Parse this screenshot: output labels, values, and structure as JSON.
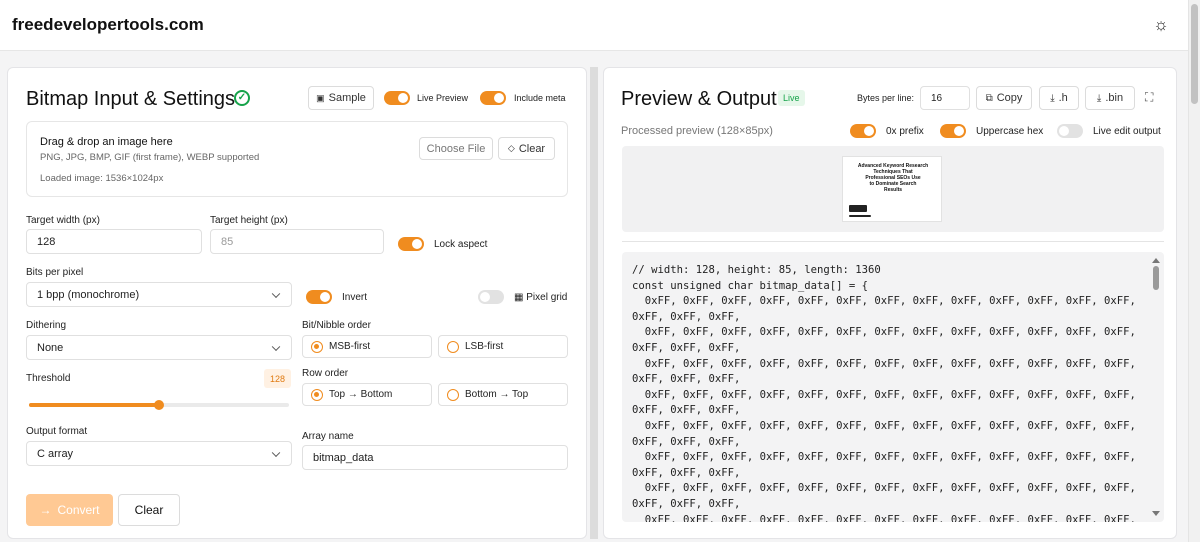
{
  "header": {
    "brand": "freedevelopertools.com",
    "theme_icon": "sun-icon"
  },
  "left": {
    "title": "Bitmap Input & Settings",
    "sample_label": "Sample",
    "live_preview_label": "Live Preview",
    "include_meta_label": "Include meta",
    "drop_title": "Drag & drop an image here",
    "drop_formats": "PNG, JPG, BMP, GIF (first frame), WEBP supported",
    "loaded_image": "Loaded image: 1536×1024px",
    "choose_file_label": "Choose File",
    "clear_label": "Clear",
    "target_width_label": "Target width (px)",
    "target_width_value": "128",
    "target_height_label": "Target height (px)",
    "target_height_value": "85",
    "lock_aspect_label": "Lock aspect",
    "bpp_label": "Bits per pixel",
    "bpp_value": "1 bpp (monochrome)",
    "invert_label": "Invert",
    "pixel_grid_label": "Pixel grid",
    "dithering_label": "Dithering",
    "dithering_value": "None",
    "bit_order_label": "Bit/Nibble order",
    "msb_label": "MSB-first",
    "lsb_label": "LSB-first",
    "threshold_label": "Threshold",
    "threshold_value": "128",
    "threshold_fraction": 0.5,
    "row_order_label": "Row order",
    "top_bottom_label": "Top → Bottom",
    "bottom_top_label": "Bottom → Top",
    "output_format_label": "Output format",
    "output_format_value": "C array",
    "array_name_label": "Array name",
    "array_name_value": "bitmap_data",
    "convert_label": "Convert",
    "clear2_label": "Clear"
  },
  "right": {
    "title": "Preview & Output",
    "live_badge": "Live",
    "bytes_per_line_label": "Bytes per line:",
    "bytes_per_line_value": "16",
    "copy_label": "Copy",
    "h_label": ".h",
    "bin_label": ".bin",
    "processed_preview_label": "Processed preview (128×85px)",
    "prefix_label": "0x prefix",
    "uppercase_label": "Uppercase hex",
    "live_edit_label": "Live edit output",
    "code_lines": [
      "// width: 128, height: 85, length: 1360",
      "const unsigned char bitmap_data[] = {",
      "  0xFF, 0xFF, 0xFF, 0xFF, 0xFF, 0xFF, 0xFF, 0xFF, 0xFF, 0xFF, 0xFF, 0xFF, 0xFF, 0xFF, 0xFF, 0xFF,",
      "  0xFF, 0xFF, 0xFF, 0xFF, 0xFF, 0xFF, 0xFF, 0xFF, 0xFF, 0xFF, 0xFF, 0xFF, 0xFF, 0xFF, 0xFF, 0xFF,",
      "  0xFF, 0xFF, 0xFF, 0xFF, 0xFF, 0xFF, 0xFF, 0xFF, 0xFF, 0xFF, 0xFF, 0xFF, 0xFF, 0xFF, 0xFF, 0xFF,",
      "  0xFF, 0xFF, 0xFF, 0xFF, 0xFF, 0xFF, 0xFF, 0xFF, 0xFF, 0xFF, 0xFF, 0xFF, 0xFF, 0xFF, 0xFF, 0xFF,",
      "  0xFF, 0xFF, 0xFF, 0xFF, 0xFF, 0xFF, 0xFF, 0xFF, 0xFF, 0xFF, 0xFF, 0xFF, 0xFF, 0xFF, 0xFF, 0xFF,",
      "  0xFF, 0xFF, 0xFF, 0xFF, 0xFF, 0xFF, 0xFF, 0xFF, 0xFF, 0xFF, 0xFF, 0xFF, 0xFF, 0xFF, 0xFF, 0xFF,",
      "  0xFF, 0xFF, 0xFF, 0xFF, 0xFF, 0xFF, 0xFF, 0xFF, 0xFF, 0xFF, 0xFF, 0xFF, 0xFF, 0xFF, 0xFF, 0xFF,",
      "  0xFF, 0xFF, 0xFF, 0xFF, 0xFF, 0xFF, 0xFF, 0xFF, 0xFF, 0xFF, 0xFF, 0xFF, 0xFF, 0xFF, 0xFF, 0xFF,"
    ],
    "thumb_text": [
      "Advanced Keyword Research",
      "Techniques That",
      "Professional SEOs Use",
      "to Dominate Search",
      "Results"
    ]
  },
  "colors": {
    "accent": "#f08c1f",
    "success": "#16a34a"
  }
}
